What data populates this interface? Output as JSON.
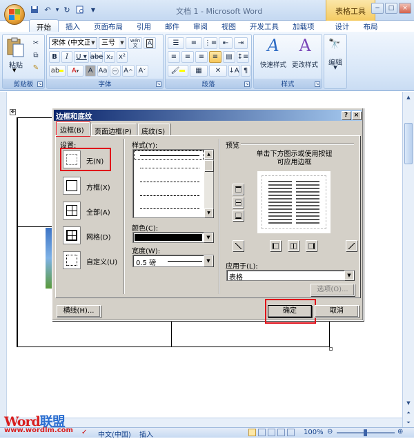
{
  "window": {
    "title": "文档 1 - Microsoft Word",
    "contextual_tab": "表格工具"
  },
  "ribbon_tabs": [
    "开始",
    "插入",
    "页面布局",
    "引用",
    "邮件",
    "审阅",
    "视图",
    "开发工具",
    "加载项",
    "设计",
    "布局"
  ],
  "ribbon": {
    "clipboard": {
      "paste": "粘贴",
      "label": "剪贴板"
    },
    "font": {
      "name": "宋体 (中文正文)",
      "size": "三号",
      "label": "字体",
      "wen": "wén",
      "a": "A"
    },
    "paragraph": {
      "label": "段落"
    },
    "styles": {
      "quick": "快速样式",
      "change": "更改样式",
      "label": "样式"
    },
    "editing": {
      "label": "编辑"
    }
  },
  "dialog": {
    "title": "边框和底纹",
    "tabs": [
      "边框(B)",
      "页面边框(P)",
      "底纹(S)"
    ],
    "setting_label": "设置:",
    "settings": [
      {
        "label": "无(N)",
        "icon": "border-none-icon"
      },
      {
        "label": "方框(X)",
        "icon": "border-box-icon"
      },
      {
        "label": "全部(A)",
        "icon": "border-all-icon"
      },
      {
        "label": "网格(D)",
        "icon": "border-grid-icon"
      },
      {
        "label": "自定义(U)",
        "icon": "border-custom-icon"
      }
    ],
    "style_label": "样式(Y):",
    "color_label": "颜色(C):",
    "width_label": "宽度(W):",
    "width_value": "0.5 磅",
    "preview_label": "预览",
    "preview_hint": "单击下方图示或使用按钮可应用边框",
    "apply_label": "应用于(L):",
    "apply_value": "表格",
    "options_button": "选项(O)...",
    "hline_button": "横线(H)...",
    "ok_button": "确定",
    "cancel_button": "取消"
  },
  "statusbar": {
    "language": "中文(中国)",
    "mode": "插入",
    "zoom": "100%"
  },
  "watermark": {
    "brand_1": "Word",
    "brand_2": "联盟",
    "url": "www.wordlm.com"
  },
  "colors": {
    "highlight": "#e0101a",
    "dialog_title": "#0a246a",
    "ribbon": "#d7e6f8"
  }
}
